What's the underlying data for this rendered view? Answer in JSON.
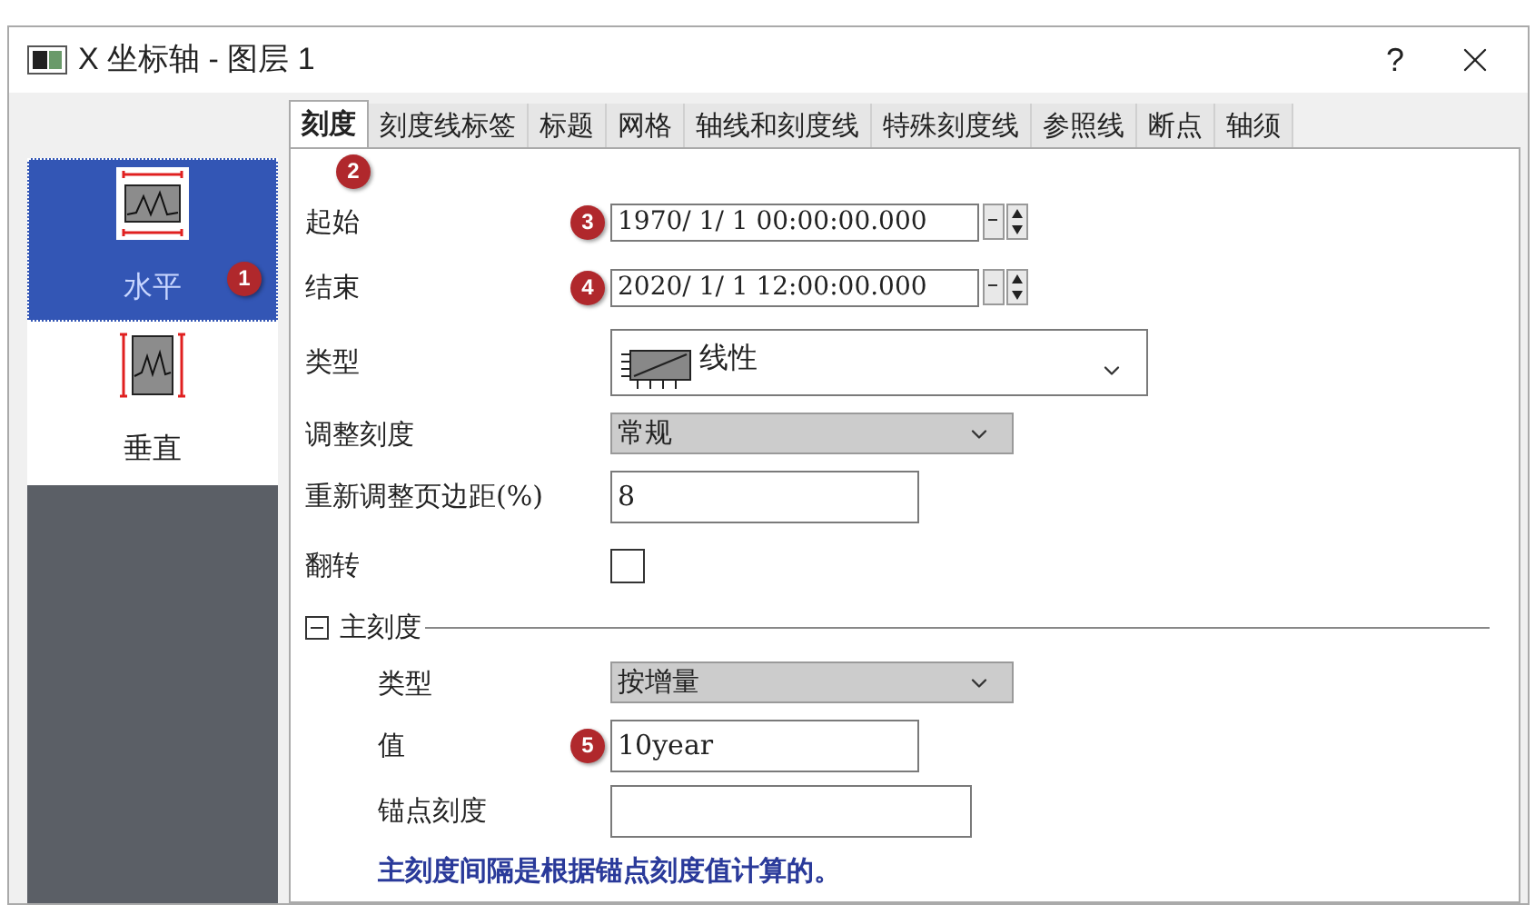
{
  "window": {
    "title": "X 坐标轴 - 图层 1",
    "help": "?"
  },
  "tabs": [
    {
      "label": "刻度",
      "selected": true,
      "badge": "2"
    },
    {
      "label": "刻度线标签",
      "selected": false
    },
    {
      "label": "标题",
      "selected": false
    },
    {
      "label": "网格",
      "selected": false
    },
    {
      "label": "轴线和刻度线",
      "selected": false
    },
    {
      "label": "特殊刻度线",
      "selected": false
    },
    {
      "label": "参照线",
      "selected": false
    },
    {
      "label": "断点",
      "selected": false
    },
    {
      "label": "轴须",
      "selected": false
    }
  ],
  "sidebar": {
    "items": [
      {
        "label": "水平",
        "selected": true,
        "badge": "1",
        "kind": "horizontal"
      },
      {
        "label": "垂直",
        "selected": false,
        "kind": "vertical"
      }
    ]
  },
  "form": {
    "rows": [
      {
        "kind": "datetime",
        "label": "起始",
        "value": "1970/ 1/ 1 00:00:00.000",
        "badge": "3"
      },
      {
        "kind": "datetime",
        "label": "结束",
        "value": "2020/ 1/ 1 12:00:00.000",
        "badge": "4"
      },
      {
        "kind": "icon-select",
        "label": "类型",
        "value": "线性"
      },
      {
        "kind": "select",
        "label": "调整刻度",
        "value": "常规"
      },
      {
        "kind": "text",
        "label": "重新调整页边距(%)",
        "value": "8"
      },
      {
        "kind": "checkbox",
        "label": "翻转",
        "checked": false
      }
    ],
    "section": {
      "title": "主刻度",
      "expanded": true,
      "rows": [
        {
          "kind": "select",
          "label": "类型",
          "value": "按增量"
        },
        {
          "kind": "text",
          "label": "值",
          "value": "10year",
          "badge": "5"
        },
        {
          "kind": "text-wide",
          "label": "锚点刻度",
          "value": ""
        }
      ],
      "note": "主刻度间隔是根据锚点刻度值计算的。"
    }
  }
}
